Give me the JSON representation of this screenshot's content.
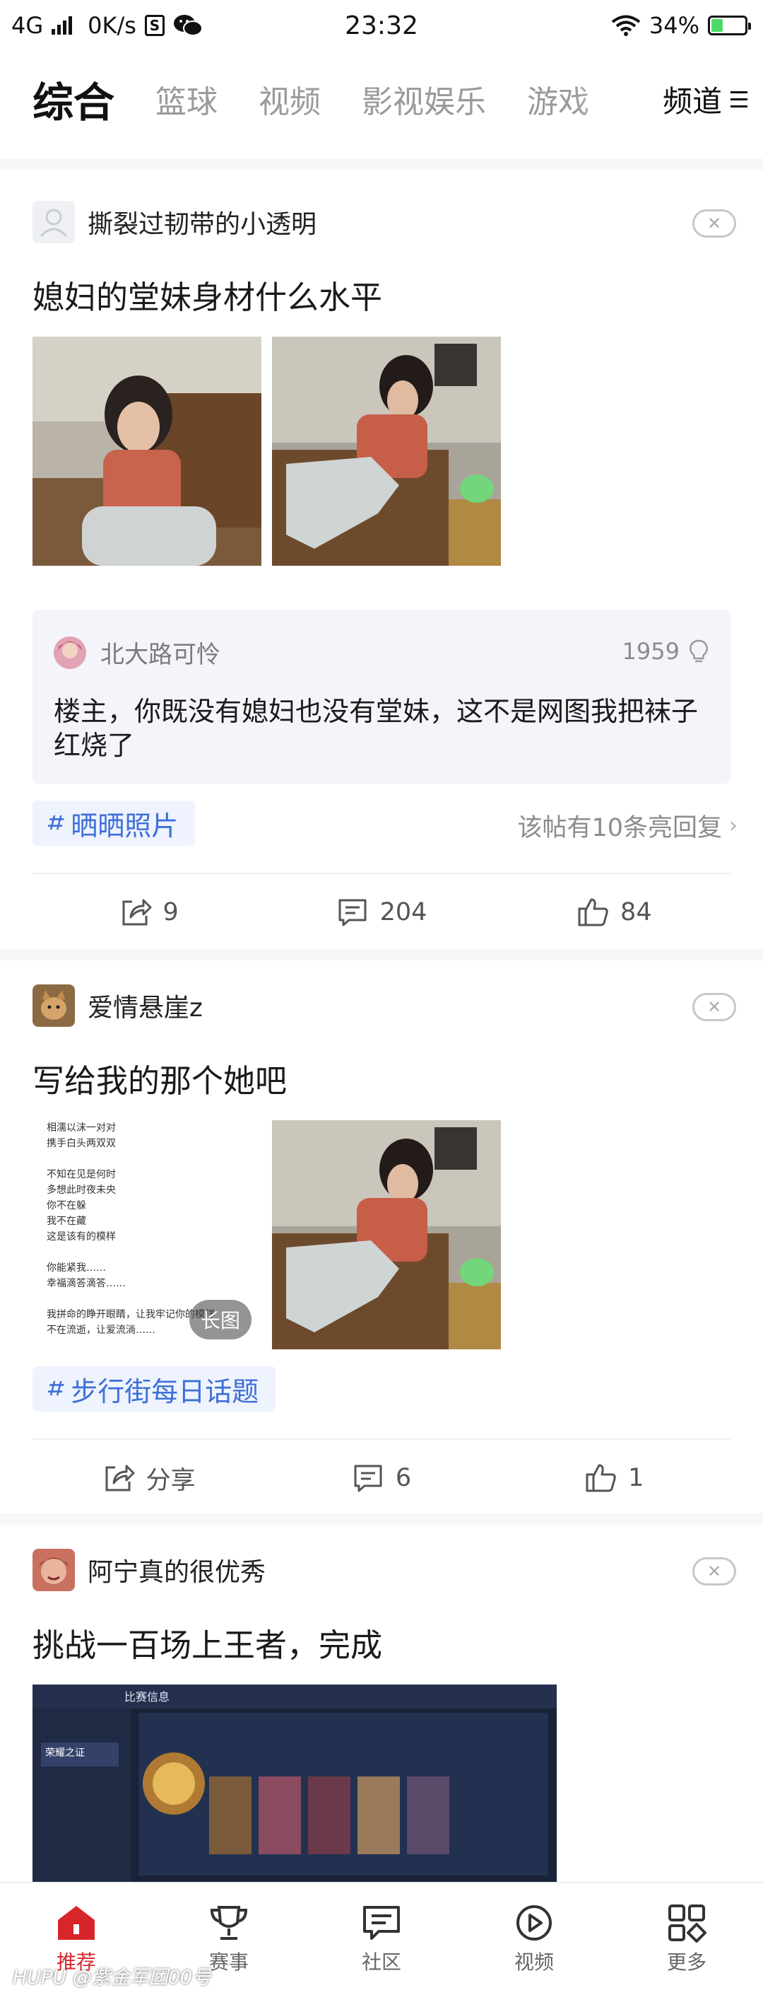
{
  "status_bar": {
    "network": "4G",
    "speed": "0K/s",
    "time": "23:32",
    "battery": "34%",
    "battery_level": 0.34,
    "icons": [
      "signal-icon",
      "sim-icon",
      "wechat-icon",
      "wifi-icon",
      "battery-icon"
    ]
  },
  "tabs": {
    "items": [
      {
        "label": "综合",
        "active": true
      },
      {
        "label": "篮球"
      },
      {
        "label": "视频"
      },
      {
        "label": "影视娱乐"
      },
      {
        "label": "游戏"
      }
    ],
    "channel_label": "频道"
  },
  "posts": [
    {
      "author": "撕裂过韧带的小透明",
      "title": "媳妇的堂妹身材什么水平",
      "hot_comment": {
        "user": "北大路可怜",
        "likes": "1959",
        "text": "楼主，你既没有媳妇也没有堂妹，这不是网图我把袜子红烧了"
      },
      "topic": "晒晒照片",
      "light_replies": "该帖有10条亮回复",
      "share": "9",
      "comments": "204",
      "likes": "84"
    },
    {
      "author": "爱情悬崖z",
      "title": "写给我的那个她吧",
      "long_image_badge": "长图",
      "poem_lines": [
        "相濡以沫一对对",
        "携手白头两双双",
        "",
        "不知在见是何时",
        "多想此时夜未央",
        "你不在躲",
        "我不在藏",
        "这是该有的模样",
        "",
        "你能紧我……",
        "幸福滴答滴答……",
        "",
        "我拼命的睁开眼睛，让我牢记你的模样",
        "不在流逝，让爱流淌……"
      ],
      "topic": "步行街每日话题",
      "share": "分享",
      "comments": "6",
      "likes": "1"
    },
    {
      "author": "阿宁真的很优秀",
      "title": "挑战一百场上王者，完成",
      "game_header": "比赛信息",
      "game_rank": "荣耀之证"
    }
  ],
  "bottom_nav": [
    {
      "label": "推荐",
      "icon": "home-icon",
      "active": true
    },
    {
      "label": "赛事",
      "icon": "trophy-icon"
    },
    {
      "label": "社区",
      "icon": "community-icon"
    },
    {
      "label": "视频",
      "icon": "play-icon"
    },
    {
      "label": "更多",
      "icon": "more-grid-icon"
    }
  ],
  "watermark": "HUPU @紫金军团00号",
  "colors": {
    "accent_red": "#d7262a",
    "topic_blue": "#3d6fd8",
    "comment_bg": "#f4f5fa"
  }
}
